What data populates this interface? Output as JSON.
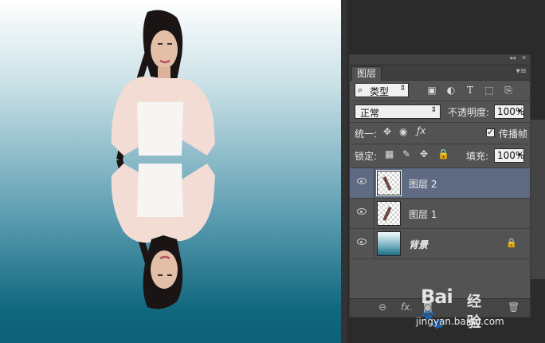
{
  "layers_panel": {
    "tab_title": "图层",
    "filter": {
      "selected": "类型"
    },
    "filter_icons": [
      "image-filter-icon",
      "adjustment-filter-icon",
      "type-filter-icon",
      "shape-filter-icon",
      "smart-object-filter-icon"
    ],
    "filter_type_glyph": "T",
    "blend_mode": "正常",
    "opacity_label": "不透明度:",
    "opacity_value": "100%",
    "unify_label": "统一:",
    "propagate_label": "传播帧",
    "propagate_frame": "1",
    "lock_label": "锁定:",
    "fill_label": "填充:",
    "fill_value": "100%",
    "layers": [
      {
        "name": "图层 2",
        "selected": true,
        "visible": true,
        "locked": false
      },
      {
        "name": "图层 1",
        "selected": false,
        "visible": true,
        "locked": false
      },
      {
        "name": "背景",
        "selected": false,
        "visible": true,
        "locked": true
      }
    ],
    "bottom_icons": [
      "link-icon",
      "fx-icon"
    ],
    "bottom_fx_text": "fx."
  },
  "watermark": {
    "logo": "Bai🐾",
    "site_cn": "经验",
    "url": "jingyan.baidu.com"
  },
  "colors": {
    "panel_bg": "#535353",
    "selected_layer": "#5f6b82",
    "canvas_top": "#ffffff",
    "canvas_bottom": "#0d6078"
  }
}
